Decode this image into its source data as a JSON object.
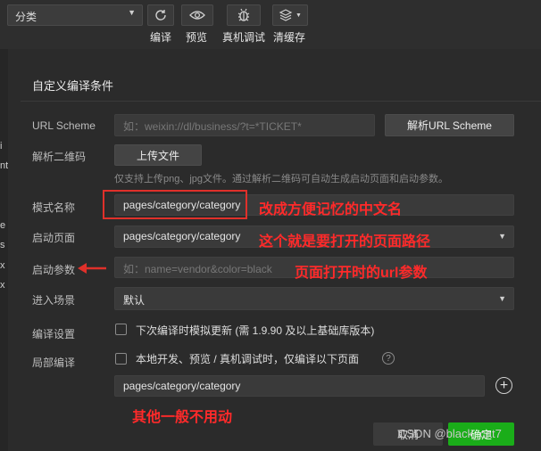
{
  "toolbar": {
    "mode_select_value": "分类",
    "buttons": [
      {
        "label": "编译",
        "icon": "refresh-icon"
      },
      {
        "label": "预览",
        "icon": "eye-icon"
      },
      {
        "label": "真机调试",
        "icon": "bug-icon"
      },
      {
        "label": "清缓存",
        "icon": "layers-icon"
      }
    ]
  },
  "left_strip_chars": [
    "i",
    "nt",
    "e",
    "s",
    "x",
    "x"
  ],
  "panel": {
    "title": "自定义编译条件",
    "url_scheme": {
      "label": "URL Scheme",
      "placeholder": "如：weixin://dl/business/?t=*TICKET*",
      "parse_button": "解析URL Scheme"
    },
    "qrcode": {
      "label": "解析二维码",
      "upload_button": "上传文件",
      "hint": "仅支持上传png、jpg文件。通过解析二维码可自动生成启动页面和启动参数。"
    },
    "mode_name": {
      "label": "模式名称",
      "value": "pages/category/category"
    },
    "start_page": {
      "label": "启动页面",
      "value": "pages/category/category"
    },
    "start_params": {
      "label": "启动参数",
      "placeholder": "如：name=vendor&color=black"
    },
    "scene": {
      "label": "进入场景",
      "value": "默认"
    },
    "compile_settings": {
      "label": "编译设置",
      "checkbox_text": "下次编译时模拟更新 (需 1.9.90 及以上基础库版本)"
    },
    "partial_compile": {
      "label": "局部编译",
      "checkbox_text": "本地开发、预览 / 真机调试时，仅编译以下页面",
      "help": "?",
      "page_value": "pages/category/category"
    }
  },
  "annotations": {
    "mode_name_note": "改成方便记忆的中文名",
    "start_page_note": "这个就是要打开的页面路径",
    "start_params_note": "页面打开时的url参数",
    "other_note": "其他一般不用动"
  },
  "footer": {
    "cancel_button": "取消",
    "confirm_button": "确定",
    "watermark": "CSDN @black_cat7"
  },
  "colors": {
    "annotation_red": "#ff2a2a",
    "confirm_green": "#1aad19",
    "background": "#2c2c2c"
  }
}
